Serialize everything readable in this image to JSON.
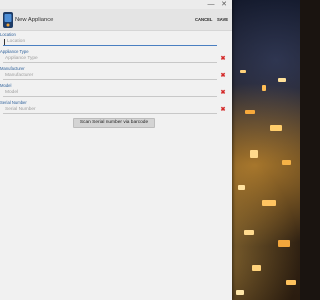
{
  "window": {
    "minimize_glyph": "—",
    "close_glyph": "✕"
  },
  "app_bar": {
    "title": "New Appliance",
    "cancel_label": "CANCEL",
    "save_label": "SAVE",
    "icon": "app-logo-icon"
  },
  "form": {
    "fields": [
      {
        "label": "Location",
        "placeholder": "Location",
        "value": "",
        "focused": true
      },
      {
        "label": "Appliance Type",
        "placeholder": "Appliance Type",
        "value": ""
      },
      {
        "label": "Manufacturer",
        "placeholder": "Manufacturer",
        "value": ""
      },
      {
        "label": "Model",
        "placeholder": "Model",
        "value": ""
      },
      {
        "label": "Serial Number",
        "placeholder": "Serial Number",
        "value": ""
      }
    ],
    "clear_glyph": "✖",
    "clear_color": "#d42a2a",
    "label_color": "#2b5f9a",
    "scan_button_label": "Scan Serial number via barcode"
  }
}
